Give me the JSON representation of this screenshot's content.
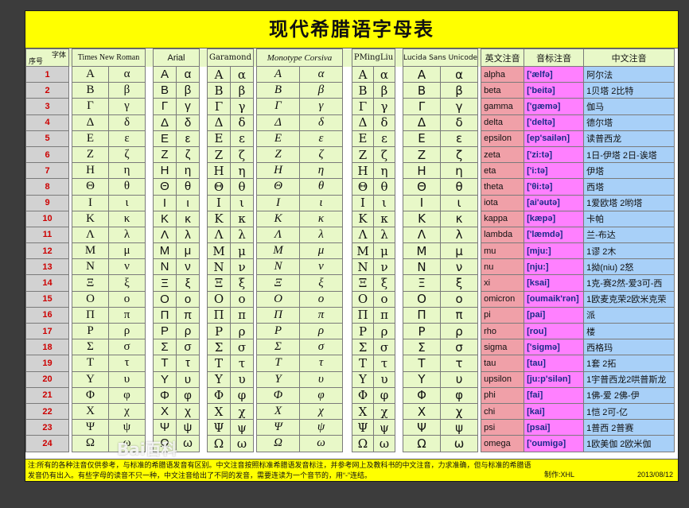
{
  "title": "现代希腊语字母表",
  "header": {
    "corner_top": "字体",
    "corner_bottom": "序号",
    "fonts": [
      "Times New Roman",
      "Arial",
      "Garamond",
      "Monotype Corsiva",
      "PMingLiu",
      "Lucida Sans Unicode"
    ],
    "col_en": "英文注音",
    "col_ipa": "音标注音",
    "col_zh": "中文注音"
  },
  "rows": [
    {
      "n": "1",
      "U": "Α",
      "l": "α",
      "en": "alpha",
      "ipa": "['ælfə]",
      "zh": "阿尔法"
    },
    {
      "n": "2",
      "U": "Β",
      "l": "β",
      "en": "beta",
      "ipa": "['beitə]",
      "zh": "1贝塔 2比特"
    },
    {
      "n": "3",
      "U": "Γ",
      "l": "γ",
      "en": "gamma",
      "ipa": "['gæmə]",
      "zh": "伽马"
    },
    {
      "n": "4",
      "U": "Δ",
      "l": "δ",
      "en": "delta",
      "ipa": "['deltə]",
      "zh": "德尔塔"
    },
    {
      "n": "5",
      "U": "Ε",
      "l": "ε",
      "en": "epsilon",
      "ipa": "[ep'sailən]",
      "zh": "读普西龙"
    },
    {
      "n": "6",
      "U": "Ζ",
      "l": "ζ",
      "en": "zeta",
      "ipa": "['zi:tə]",
      "zh": "1日-伊塔 2日-诶塔"
    },
    {
      "n": "7",
      "U": "Η",
      "l": "η",
      "en": "eta",
      "ipa": "['i:tə]",
      "zh": "伊塔"
    },
    {
      "n": "8",
      "U": "Θ",
      "l": "θ",
      "en": "theta",
      "ipa": "['θi:tə]",
      "zh": "西塔"
    },
    {
      "n": "9",
      "U": "Ι",
      "l": "ι",
      "en": "iota",
      "ipa": "[ai'əutə]",
      "zh": "1爱欧塔 2哟塔"
    },
    {
      "n": "10",
      "U": "Κ",
      "l": "κ",
      "en": "kappa",
      "ipa": "[kæpə]",
      "zh": "卡帕"
    },
    {
      "n": "11",
      "U": "Λ",
      "l": "λ",
      "en": "lambda",
      "ipa": "['læmdə]",
      "zh": "兰-布达"
    },
    {
      "n": "12",
      "U": "Μ",
      "l": "μ",
      "en": "mu",
      "ipa": "[mju:]",
      "zh": "1谬 2木"
    },
    {
      "n": "13",
      "U": "Ν",
      "l": "ν",
      "en": "nu",
      "ipa": "[nju:]",
      "zh": "1拗(niu) 2怒"
    },
    {
      "n": "14",
      "U": "Ξ",
      "l": "ξ",
      "en": "xi",
      "ipa": "[ksai]",
      "zh": "1克-赛2然-爱3可-西"
    },
    {
      "n": "15",
      "U": "Ο",
      "l": "ο",
      "en": "omicron",
      "ipa": "[oumaik'rən]",
      "zh": "1欧麦克荣2欧米克荣"
    },
    {
      "n": "16",
      "U": "Π",
      "l": "π",
      "en": "pi",
      "ipa": "[pai]",
      "zh": "派"
    },
    {
      "n": "17",
      "U": "Ρ",
      "l": "ρ",
      "en": "rho",
      "ipa": "[rou]",
      "zh": "楼"
    },
    {
      "n": "18",
      "U": "Σ",
      "l": "σ",
      "en": "sigma",
      "ipa": "['sigmə]",
      "zh": "西格玛"
    },
    {
      "n": "19",
      "U": "Τ",
      "l": "τ",
      "en": "tau",
      "ipa": "[tau]",
      "zh": "1套 2拓"
    },
    {
      "n": "20",
      "U": "Υ",
      "l": "υ",
      "en": "upsilon",
      "ipa": "[ju:p'silən]",
      "zh": "1宇普西龙2哄普斯龙"
    },
    {
      "n": "21",
      "U": "Φ",
      "l": "φ",
      "en": "phi",
      "ipa": "[fai]",
      "zh": "1佛-爱 2佛-伊"
    },
    {
      "n": "22",
      "U": "Χ",
      "l": "χ",
      "en": "chi",
      "ipa": "[kai]",
      "zh": "1恺 2可-亿"
    },
    {
      "n": "23",
      "U": "Ψ",
      "l": "ψ",
      "en": "psi",
      "ipa": "[psai]",
      "zh": "1普西 2普赛"
    },
    {
      "n": "24",
      "U": "Ω",
      "l": "ω",
      "en": "omega",
      "ipa": "['oumigə]",
      "zh": "1欧美伽 2欧米伽"
    }
  ],
  "note_line1": "注:所有的各种注音仅供参考，与标准的希腊语发音有区别。中文注音按照标准希腊语发音标注，并参考网上及教科书的中文注音，力求准确，但与标准的希腊语",
  "note_line2": "发音仍有出入。有些字母的读音不只一种，中文注音给出了不同的发音，需要连读为一个音节的，用“-”连结。",
  "author": "制作:XHL",
  "date": "2013/08/12",
  "watermark": "Bai百科"
}
